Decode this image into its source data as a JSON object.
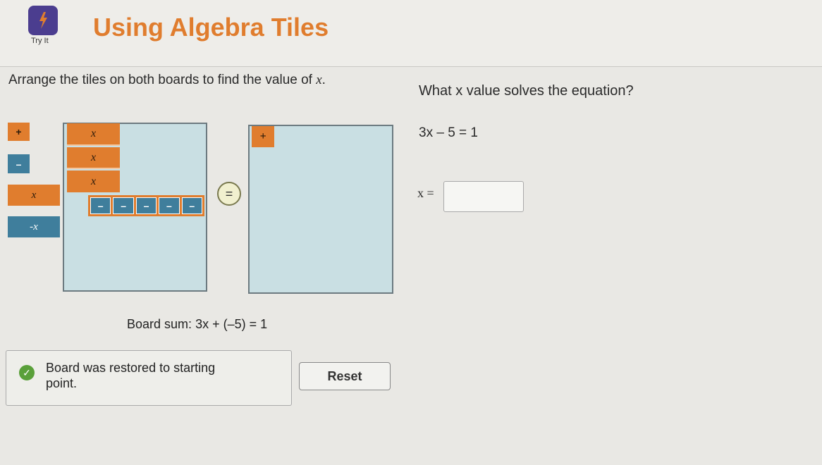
{
  "header": {
    "title": "Using Algebra Tiles",
    "tryit_label": "Try It",
    "tryit_icon": "lightning-bolt-icon"
  },
  "instruction": {
    "prefix": "Arrange the tiles on both boards to find the value of ",
    "variable": "x",
    "suffix": "."
  },
  "palette": {
    "positive_unit": "+",
    "negative_unit": "–",
    "positive_x": "x",
    "negative_x": "-x"
  },
  "left_board": {
    "x_tiles": [
      "x",
      "x",
      "x"
    ],
    "negative_units": [
      "–",
      "–",
      "–",
      "–",
      "–"
    ]
  },
  "right_board": {
    "positive_units": [
      "+"
    ]
  },
  "equals_sign": "=",
  "board_sum": {
    "label": "Board sum:",
    "expression": "3x + (–5) = 1"
  },
  "feedback": {
    "message": "Board was restored to starting point.",
    "icon": "check-circle-icon"
  },
  "reset_label": "Reset",
  "question": {
    "text": "What x value solves the equation?",
    "equation": "3x – 5 = 1",
    "answer_label": "x =",
    "answer_value": ""
  },
  "colors": {
    "orange": "#e07d2e",
    "blue": "#3f7e9c",
    "board": "#c9dfe3",
    "check": "#5aa03a",
    "brand_icon": "#4b3d8f"
  }
}
